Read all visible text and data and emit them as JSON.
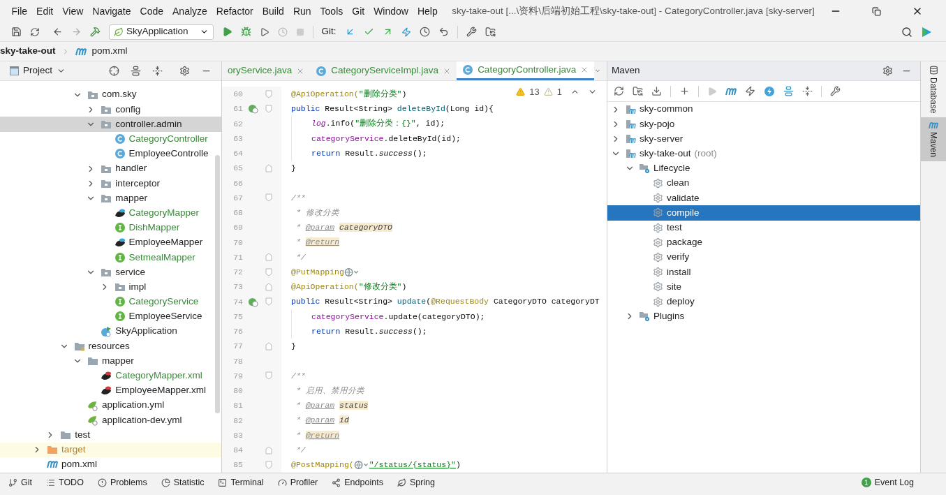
{
  "window": {
    "title": "sky-take-out [...\\资料\\后端初始工程\\sky-take-out] - CategoryController.java [sky-server]",
    "menu": [
      "File",
      "Edit",
      "View",
      "Navigate",
      "Code",
      "Analyze",
      "Refactor",
      "Build",
      "Run",
      "Tools",
      "Git",
      "Window",
      "Help"
    ]
  },
  "toolbar": {
    "run_config": "SkyApplication",
    "git_label": "Git:"
  },
  "breadcrumb": [
    "sky-take-out",
    "pom.xml"
  ],
  "project": {
    "title": "Project",
    "tree": [
      {
        "children": [
          {
            "children": [
              {
                "children": [
                  {
                    "label": "com.sky",
                    "kind": "package",
                    "expanded": true,
                    "selected": false,
                    "added": false,
                    "ignored": false,
                    "children": [
                      {
                        "label": "config",
                        "kind": "package",
                        "expanded": false,
                        "selected": false,
                        "added": false,
                        "ignored": false
                      },
                      {
                        "label": "controller.admin",
                        "kind": "package",
                        "expanded": true,
                        "selected": true,
                        "added": false,
                        "ignored": false,
                        "children": [
                          {
                            "label": "CategoryController",
                            "kind": "class",
                            "selected": false,
                            "added": true,
                            "ignored": false
                          },
                          {
                            "label": "EmployeeControlle",
                            "kind": "class",
                            "selected": false,
                            "added": false,
                            "ignored": false
                          }
                        ]
                      },
                      {
                        "label": "handler",
                        "kind": "package",
                        "expanded": false,
                        "selected": false,
                        "added": false,
                        "ignored": false
                      },
                      {
                        "label": "interceptor",
                        "kind": "package",
                        "expanded": false,
                        "selected": false,
                        "added": false,
                        "ignored": false
                      },
                      {
                        "label": "mapper",
                        "kind": "package",
                        "expanded": true,
                        "selected": false,
                        "added": false,
                        "ignored": false,
                        "children": [
                          {
                            "label": "CategoryMapper",
                            "kind": "mybatis",
                            "selected": false,
                            "added": true,
                            "ignored": false
                          },
                          {
                            "label": "DishMapper",
                            "kind": "interface",
                            "selected": false,
                            "added": true,
                            "ignored": false
                          },
                          {
                            "label": "EmployeeMapper",
                            "kind": "mybatis",
                            "selected": false,
                            "added": false,
                            "ignored": false
                          },
                          {
                            "label": "SetmealMapper",
                            "kind": "interface",
                            "selected": false,
                            "added": true,
                            "ignored": false
                          }
                        ]
                      },
                      {
                        "label": "service",
                        "kind": "package",
                        "expanded": true,
                        "selected": false,
                        "added": false,
                        "ignored": false,
                        "children": [
                          {
                            "label": "impl",
                            "kind": "package",
                            "expanded": false,
                            "selected": false,
                            "added": false,
                            "ignored": false
                          },
                          {
                            "label": "CategoryService",
                            "kind": "interface",
                            "selected": false,
                            "added": true,
                            "ignored": false
                          },
                          {
                            "label": "EmployeeService",
                            "kind": "interface",
                            "selected": false,
                            "added": false,
                            "ignored": false
                          }
                        ]
                      },
                      {
                        "label": "SkyApplication",
                        "kind": "spring-app",
                        "selected": false,
                        "added": false,
                        "ignored": false
                      }
                    ]
                  }
                ]
              },
              {
                "label": "resources",
                "kind": "resources",
                "expanded": true,
                "selected": false,
                "added": false,
                "ignored": false,
                "children": [
                  {
                    "label": "mapper",
                    "kind": "folder",
                    "expanded": true,
                    "selected": false,
                    "added": false,
                    "ignored": false,
                    "children": [
                      {
                        "label": "CategoryMapper.xml",
                        "kind": "mybatis-xml",
                        "selected": false,
                        "added": true,
                        "ignored": false
                      },
                      {
                        "label": "EmployeeMapper.xml",
                        "kind": "mybatis-xml",
                        "selected": false,
                        "added": false,
                        "ignored": false
                      }
                    ]
                  },
                  {
                    "label": "application.yml",
                    "kind": "yml",
                    "selected": false,
                    "added": false,
                    "ignored": false
                  },
                  {
                    "label": "application-dev.yml",
                    "kind": "yml",
                    "selected": false,
                    "added": false,
                    "ignored": false
                  }
                ]
              }
            ]
          },
          {
            "label": "test",
            "kind": "folder",
            "expanded": false,
            "selected": false,
            "added": false,
            "ignored": false
          }
        ]
      },
      {
        "label": "target",
        "kind": "folder",
        "expanded": false,
        "selected": false,
        "added": false,
        "ignored": true
      },
      {
        "label": "pom.xml",
        "kind": "pom",
        "selected": false,
        "added": false,
        "ignored": false
      }
    ]
  },
  "editor": {
    "tabs": [
      {
        "label": "oryService.java",
        "selected": false
      },
      {
        "label": "CategoryServiceImpl.java",
        "selected": false
      },
      {
        "label": "CategoryController.java",
        "selected": true
      }
    ],
    "warnings": "13",
    "weak_warnings": "1",
    "lines": [
      {
        "number": "60",
        "fold_start": true,
        "fold_end": false,
        "tokens": [
          {
            "text": "@ApiOperation(",
            "kind": "annotation"
          },
          {
            "text": "\"删除分类\"",
            "kind": "string"
          },
          {
            "text": ")",
            "kind": "plain"
          }
        ]
      },
      {
        "number": "61",
        "fold_start": true,
        "fold_end": false,
        "marker": true,
        "tokens": [
          {
            "text": "public ",
            "kind": "keyword"
          },
          {
            "text": "Result<String> ",
            "kind": "plain"
          },
          {
            "text": "deleteById",
            "kind": "method"
          },
          {
            "text": "(Long id){",
            "kind": "plain"
          }
        ]
      },
      {
        "number": "62",
        "fold_start": false,
        "fold_end": false,
        "body": true,
        "tokens": [
          {
            "text": "log",
            "kind": "static-field"
          },
          {
            "text": ".info(",
            "kind": "plain"
          },
          {
            "text": "\"删除分类：{}\"",
            "kind": "string"
          },
          {
            "text": ", id);",
            "kind": "plain"
          }
        ]
      },
      {
        "number": "63",
        "fold_start": false,
        "fold_end": false,
        "body": true,
        "tokens": [
          {
            "text": "categoryService",
            "kind": "field"
          },
          {
            "text": ".deleteById(id);",
            "kind": "plain"
          }
        ]
      },
      {
        "number": "64",
        "fold_start": false,
        "fold_end": false,
        "body": true,
        "tokens": [
          {
            "text": "return ",
            "kind": "keyword"
          },
          {
            "text": "Result.",
            "kind": "plain"
          },
          {
            "text": "success",
            "kind": "static"
          },
          {
            "text": "();",
            "kind": "plain"
          }
        ]
      },
      {
        "number": "65",
        "fold_start": false,
        "fold_end": true,
        "tokens": [
          {
            "text": "}",
            "kind": "plain"
          }
        ]
      },
      {
        "number": "66",
        "fold_start": false,
        "fold_end": false
      },
      {
        "number": "67",
        "fold_start": true,
        "fold_end": false,
        "tokens": [
          {
            "text": "/**",
            "kind": "comment"
          }
        ]
      },
      {
        "number": "68",
        "fold_start": false,
        "fold_end": false,
        "tokens": [
          {
            "text": " * 修改分类",
            "kind": "comment"
          }
        ]
      },
      {
        "number": "69",
        "fold_start": false,
        "fold_end": false,
        "tokens": [
          {
            "text": " * ",
            "kind": "comment"
          },
          {
            "text": "@param",
            "kind": "doctag"
          },
          {
            "text": "categoryDTO",
            "kind": "docparam"
          }
        ]
      },
      {
        "number": "70",
        "fold_start": false,
        "fold_end": false,
        "tokens": [
          {
            "text": " * ",
            "kind": "comment"
          },
          {
            "text": "@return",
            "kind": "doctag-marked"
          }
        ]
      },
      {
        "number": "71",
        "fold_start": false,
        "fold_end": true,
        "tokens": [
          {
            "text": " */",
            "kind": "comment"
          }
        ]
      },
      {
        "number": "72",
        "fold_start": true,
        "fold_end": false,
        "tokens": [
          {
            "text": "@PutMapping",
            "kind": "annotation"
          },
          {
            "kind": "endpoint-icon"
          }
        ]
      },
      {
        "number": "73",
        "fold_start": false,
        "fold_end": true,
        "tokens": [
          {
            "text": "@ApiOperation(",
            "kind": "annotation"
          },
          {
            "text": "\"修改分类\"",
            "kind": "string"
          },
          {
            "text": ")",
            "kind": "plain"
          }
        ]
      },
      {
        "number": "74",
        "fold_start": true,
        "fold_end": false,
        "marker": true,
        "tokens": [
          {
            "text": "public ",
            "kind": "keyword"
          },
          {
            "text": "Result<String> ",
            "kind": "plain"
          },
          {
            "text": "update",
            "kind": "method"
          },
          {
            "text": "(",
            "kind": "plain"
          },
          {
            "text": "@RequestBody",
            "kind": "annotation"
          },
          {
            "text": " CategoryDTO categoryDT",
            "kind": "plain"
          }
        ]
      },
      {
        "number": "75",
        "fold_start": false,
        "fold_end": false,
        "body": true,
        "tokens": [
          {
            "text": "categoryService",
            "kind": "field"
          },
          {
            "text": ".update(categoryDTO);",
            "kind": "plain"
          }
        ]
      },
      {
        "number": "76",
        "fold_start": false,
        "fold_end": false,
        "body": true,
        "tokens": [
          {
            "text": "return ",
            "kind": "keyword"
          },
          {
            "text": "Result.",
            "kind": "plain"
          },
          {
            "text": "success",
            "kind": "static"
          },
          {
            "text": "();",
            "kind": "plain"
          }
        ]
      },
      {
        "number": "77",
        "fold_start": false,
        "fold_end": true,
        "tokens": [
          {
            "text": "}",
            "kind": "plain"
          }
        ]
      },
      {
        "number": "78",
        "fold_start": false,
        "fold_end": false
      },
      {
        "number": "79",
        "fold_start": true,
        "fold_end": false,
        "tokens": [
          {
            "text": "/**",
            "kind": "comment"
          }
        ]
      },
      {
        "number": "80",
        "fold_start": false,
        "fold_end": false,
        "tokens": [
          {
            "text": " * 启用、禁用分类",
            "kind": "comment"
          }
        ]
      },
      {
        "number": "81",
        "fold_start": false,
        "fold_end": false,
        "tokens": [
          {
            "text": " * ",
            "kind": "comment"
          },
          {
            "text": "@param",
            "kind": "doctag"
          },
          {
            "text": "status",
            "kind": "docparam"
          }
        ]
      },
      {
        "number": "82",
        "fold_start": false,
        "fold_end": false,
        "tokens": [
          {
            "text": " * ",
            "kind": "comment"
          },
          {
            "text": "@param",
            "kind": "doctag"
          },
          {
            "text": "id",
            "kind": "docparam"
          }
        ]
      },
      {
        "number": "83",
        "fold_start": false,
        "fold_end": false,
        "tokens": [
          {
            "text": " * ",
            "kind": "comment"
          },
          {
            "text": "@return",
            "kind": "doctag-marked"
          }
        ]
      },
      {
        "number": "84",
        "fold_start": false,
        "fold_end": true,
        "tokens": [
          {
            "text": " */",
            "kind": "comment"
          }
        ]
      },
      {
        "number": "85",
        "fold_start": true,
        "fold_end": false,
        "tokens": [
          {
            "text": "@PostMapping(",
            "kind": "annotation"
          },
          {
            "kind": "endpoint-icon"
          },
          {
            "text": "\"/status/{status}\"",
            "kind": "url"
          },
          {
            "text": ")",
            "kind": "plain"
          }
        ]
      }
    ]
  },
  "maven": {
    "title": "Maven",
    "tree": [
      {
        "label": "sky-common",
        "kind": "module",
        "expanded": false,
        "selected": false
      },
      {
        "label": "sky-pojo",
        "kind": "module",
        "expanded": false,
        "selected": false
      },
      {
        "label": "sky-server",
        "kind": "module",
        "expanded": false,
        "selected": false
      },
      {
        "label": "sky-take-out",
        "suffix": "(root)",
        "kind": "module",
        "expanded": true,
        "selected": false,
        "children": [
          {
            "label": "Lifecycle",
            "kind": "config-folder",
            "expanded": true,
            "selected": false,
            "children": [
              {
                "label": "clean",
                "kind": "goal",
                "selected": false
              },
              {
                "label": "validate",
                "kind": "goal",
                "selected": false
              },
              {
                "label": "compile",
                "kind": "goal",
                "selected": true
              },
              {
                "label": "test",
                "kind": "goal",
                "selected": false
              },
              {
                "label": "package",
                "kind": "goal",
                "selected": false
              },
              {
                "label": "verify",
                "kind": "goal",
                "selected": false
              },
              {
                "label": "install",
                "kind": "goal",
                "selected": false
              },
              {
                "label": "site",
                "kind": "goal",
                "selected": false
              },
              {
                "label": "deploy",
                "kind": "goal",
                "selected": false
              }
            ]
          },
          {
            "label": "Plugins",
            "kind": "config-folder",
            "expanded": false,
            "selected": false
          }
        ]
      }
    ]
  },
  "side_strip": [
    {
      "label": "Database",
      "kind": "database",
      "selected": false
    },
    {
      "label": "Maven",
      "kind": "maven",
      "selected": true
    }
  ],
  "bottom_tools": [
    {
      "label": "Git",
      "kind": "git"
    },
    {
      "label": "TODO",
      "kind": "todo"
    },
    {
      "label": "Problems",
      "kind": "problems"
    },
    {
      "label": "Statistic",
      "kind": "statistic"
    },
    {
      "label": "Terminal",
      "kind": "terminal"
    },
    {
      "label": "Profiler",
      "kind": "profiler"
    },
    {
      "label": "Endpoints",
      "kind": "endpoints"
    },
    {
      "label": "Spring",
      "kind": "spring"
    }
  ],
  "event_log": {
    "label": "Event Log",
    "badge": "1"
  }
}
